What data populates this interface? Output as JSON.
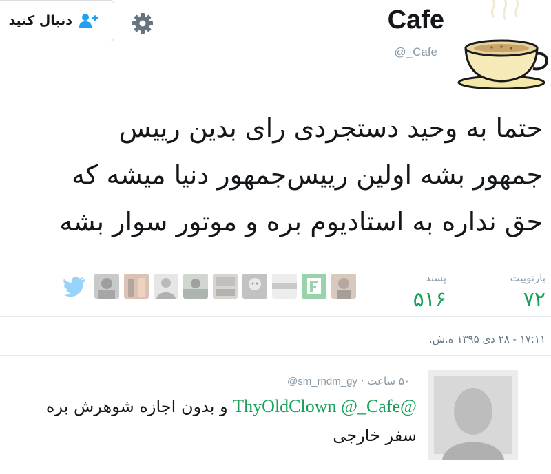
{
  "header": {
    "follow_button_label": "دنبال کنید",
    "display_name": "Cafe",
    "username": "@_Cafe"
  },
  "tweet": {
    "text_lines": [
      "حتما به وحید دستجردی رای بدین رییس",
      "جمهور بشه اولین رییس‌جمهور دنیا میشه که",
      "حق نداره به استادیوم بره و موتور سوار بشه"
    ],
    "stats": {
      "retweets_label": "بازتوییت",
      "retweets_count": "۷۲",
      "likes_label": "پسند",
      "likes_count": "۵۱۶"
    },
    "timestamp": "۱۷:۱۱ - ۲۸ دی ۱۳۹۵ ه.ش."
  },
  "reply": {
    "handle": "@sm_rndm_gy",
    "time_ago": "۵۰ ساعت",
    "mentions": "@ThyOldClown @_Cafe",
    "text_line1": "و بدون اجازه شوهرش بره",
    "text_line2": "سفر خارجی"
  },
  "icons": {
    "follow": "add-user-icon",
    "settings": "gear-icon",
    "share": "twitter-bird-icon"
  },
  "colors": {
    "accent": "#17a05a",
    "muted": "#8899a6",
    "border": "#e6ecf0",
    "icon_blue": "#1da1f2"
  }
}
